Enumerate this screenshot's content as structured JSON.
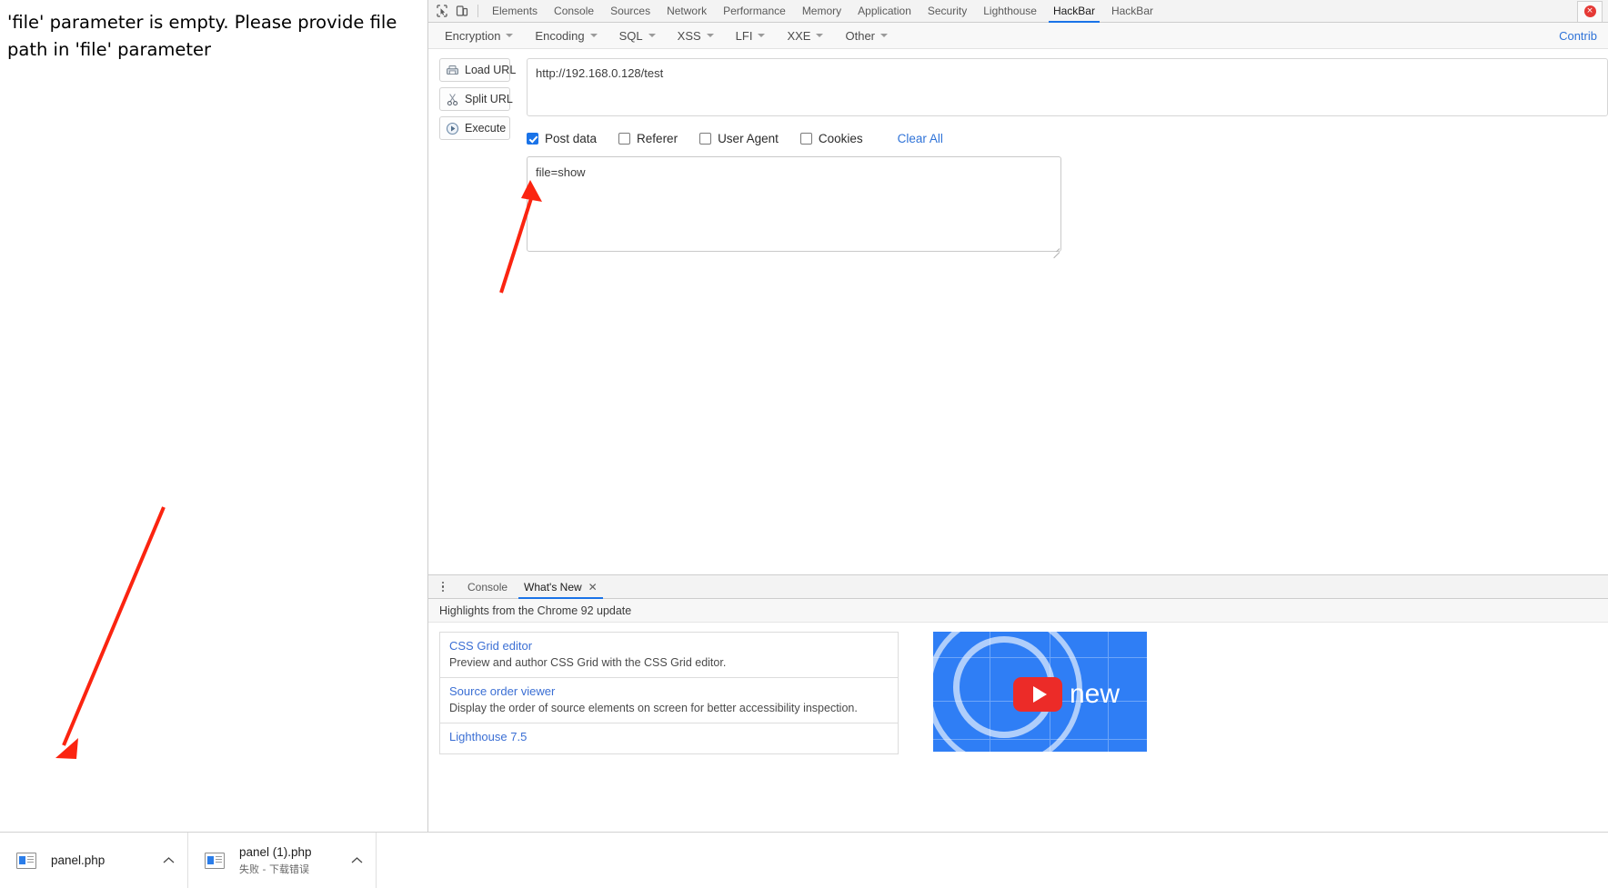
{
  "page": {
    "message": "'file' parameter is empty. Please provide file path in 'file' parameter"
  },
  "devtools": {
    "inspect_icon": "inspect-cursor-icon",
    "device_icon": "device-toolbar-icon",
    "tabs": [
      {
        "label": "Elements",
        "active": false
      },
      {
        "label": "Console",
        "active": false
      },
      {
        "label": "Sources",
        "active": false
      },
      {
        "label": "Network",
        "active": false
      },
      {
        "label": "Performance",
        "active": false
      },
      {
        "label": "Memory",
        "active": false
      },
      {
        "label": "Application",
        "active": false
      },
      {
        "label": "Security",
        "active": false
      },
      {
        "label": "Lighthouse",
        "active": false
      },
      {
        "label": "HackBar",
        "active": true
      },
      {
        "label": "HackBar",
        "active": false
      }
    ],
    "error_badge": "×"
  },
  "hackbar": {
    "menus": [
      {
        "label": "Encryption"
      },
      {
        "label": "Encoding"
      },
      {
        "label": "SQL"
      },
      {
        "label": "XSS"
      },
      {
        "label": "LFI"
      },
      {
        "label": "XXE"
      },
      {
        "label": "Other"
      }
    ],
    "contribute_label": "Contrib",
    "buttons": [
      {
        "label": "Load URL",
        "icon": "load-url-icon"
      },
      {
        "label": "Split URL",
        "icon": "scissors-icon"
      },
      {
        "label": "Execute",
        "icon": "play-icon"
      }
    ],
    "url": {
      "value": "http://192.168.0.128/test",
      "placeholder": "http://"
    },
    "checkboxes": [
      {
        "label": "Post data",
        "checked": true
      },
      {
        "label": "Referer",
        "checked": false
      },
      {
        "label": "User Agent",
        "checked": false
      },
      {
        "label": "Cookies",
        "checked": false
      }
    ],
    "clear_all_label": "Clear All",
    "post_data": {
      "value": "file=show",
      "placeholder": "post data"
    }
  },
  "drawer": {
    "menu_icon": "kebab-menu-icon",
    "tabs": [
      {
        "label": "Console",
        "active": false,
        "closable": false
      },
      {
        "label": "What's New",
        "active": true,
        "closable": true
      }
    ],
    "close_glyph": "✕",
    "whats_new": {
      "heading": "Highlights from the Chrome 92 update",
      "cards": [
        {
          "title": "CSS Grid editor",
          "desc": "Preview and author CSS Grid with the CSS Grid editor."
        },
        {
          "title": "Source order viewer",
          "desc": "Display the order of source elements on screen for better accessibility inspection."
        },
        {
          "title": "Lighthouse 7.5",
          "desc": ""
        }
      ],
      "video": {
        "label": "new",
        "play_icon": "youtube-play-icon"
      }
    }
  },
  "downloads": [
    {
      "name": "panel.php",
      "status": "",
      "icon": "file-php-icon",
      "caret": "chevron-up-icon"
    },
    {
      "name": "panel (1).php",
      "status": "失败 - 下载错误",
      "icon": "file-php-icon",
      "caret": "chevron-up-icon"
    }
  ],
  "annotations": {
    "arrow_color": "#fb2410"
  }
}
